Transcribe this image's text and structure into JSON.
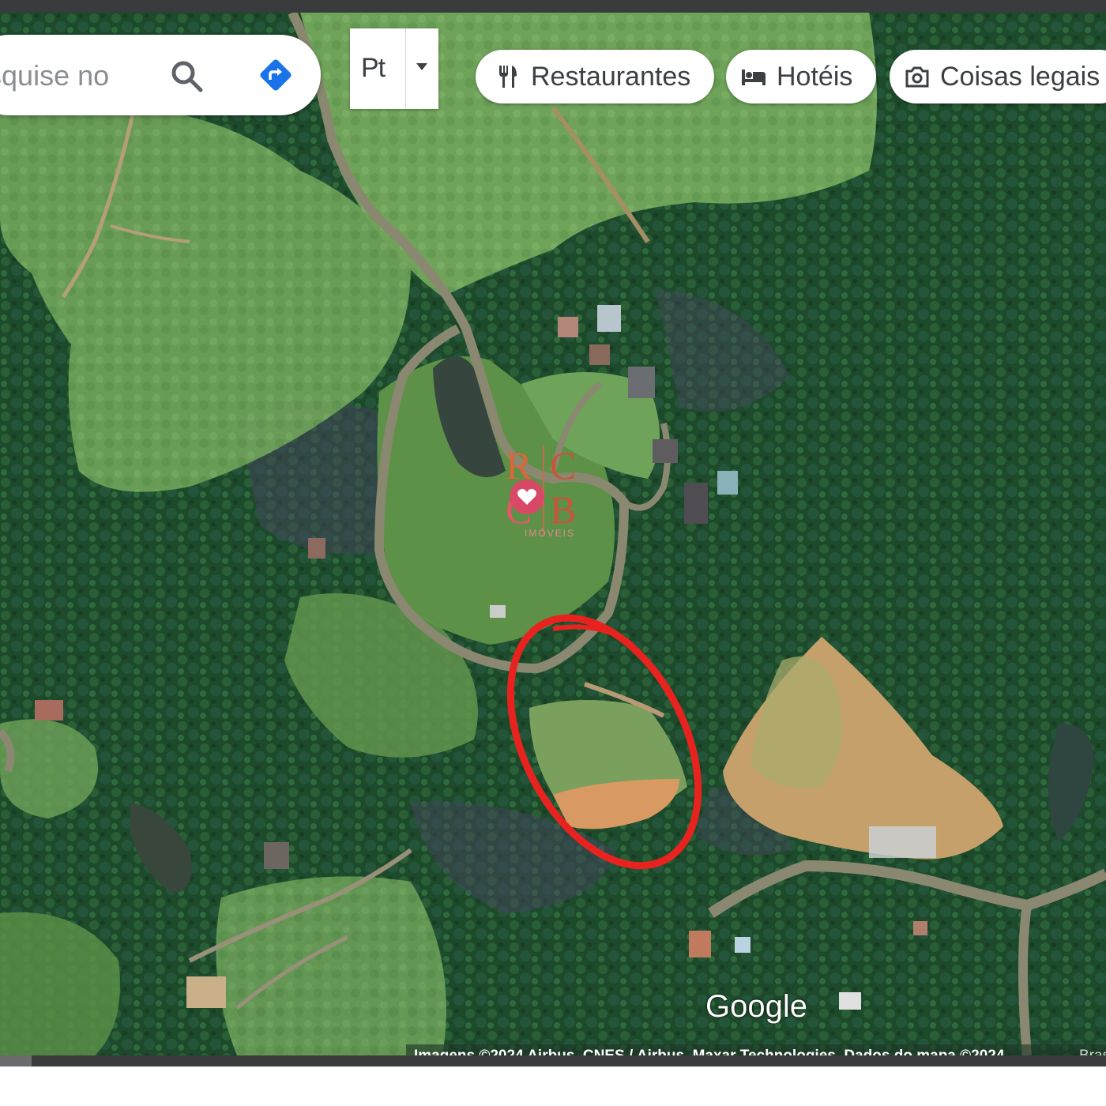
{
  "search": {
    "placeholder": "Pesquise no Google Maps"
  },
  "language_toggle": {
    "label": "Pt"
  },
  "chips": [
    {
      "label": "Restaurantes",
      "icon": "fork-knife-icon"
    },
    {
      "label": "Hotéis",
      "icon": "bed-icon"
    },
    {
      "label": "Coisas legais",
      "icon": "camera-icon"
    }
  ],
  "watermark": {
    "letters": [
      "R",
      "C",
      "C",
      "B"
    ],
    "subtitle": "IMÓVEIS"
  },
  "map": {
    "google_label": "Google",
    "attribution": "Imagens ©2024 Airbus, CNES / Airbus, Maxar Technologies, Dados do mapa ©2024",
    "attribution_extra": "Brasil",
    "highlight_color": "#e8231f"
  }
}
